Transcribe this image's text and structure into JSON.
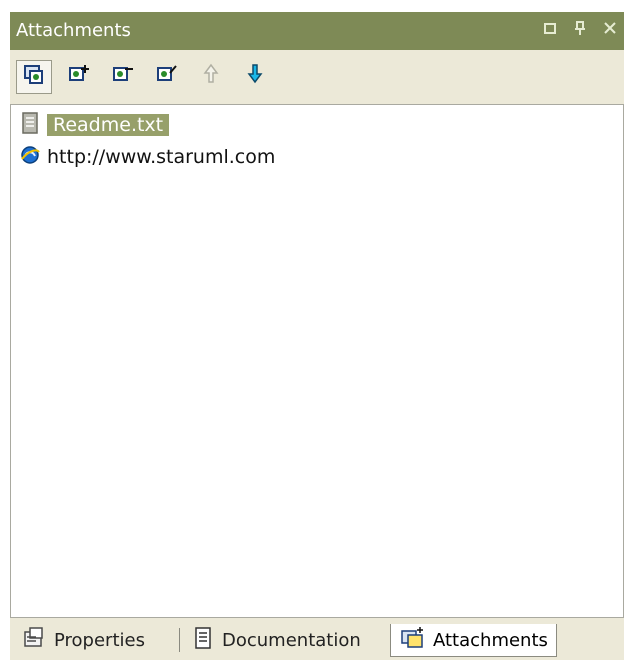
{
  "window": {
    "title": "Attachments",
    "controls": [
      "restore-icon",
      "pin-icon",
      "close-icon"
    ]
  },
  "toolbar": {
    "buttons": [
      {
        "name": "view-attachments-button",
        "icon": "attachments-icon",
        "active": true
      },
      {
        "name": "add-attachment-button",
        "icon": "add-attachment-icon",
        "active": false
      },
      {
        "name": "remove-attachment-button",
        "icon": "remove-attachment-icon",
        "active": false
      },
      {
        "name": "edit-attachment-button",
        "icon": "edit-attachment-icon",
        "active": false
      },
      {
        "name": "move-up-button",
        "icon": "arrow-up-icon",
        "active": false
      },
      {
        "name": "move-down-button",
        "icon": "arrow-down-icon",
        "active": false
      }
    ]
  },
  "list": {
    "items": [
      {
        "label": "Readme.txt",
        "icon": "text-file-icon",
        "selected": true
      },
      {
        "label": "http://www.staruml.com",
        "icon": "web-link-icon",
        "selected": false
      }
    ]
  },
  "tabs": [
    {
      "label": "Properties",
      "icon": "properties-icon",
      "selected": false
    },
    {
      "label": "Documentation",
      "icon": "document-icon",
      "selected": false
    },
    {
      "label": "Attachments",
      "icon": "attachments-icon",
      "selected": true
    }
  ],
  "colors": {
    "titlebar": "#7e8a56",
    "selection": "#97a06a",
    "panel": "#ece9d8"
  }
}
